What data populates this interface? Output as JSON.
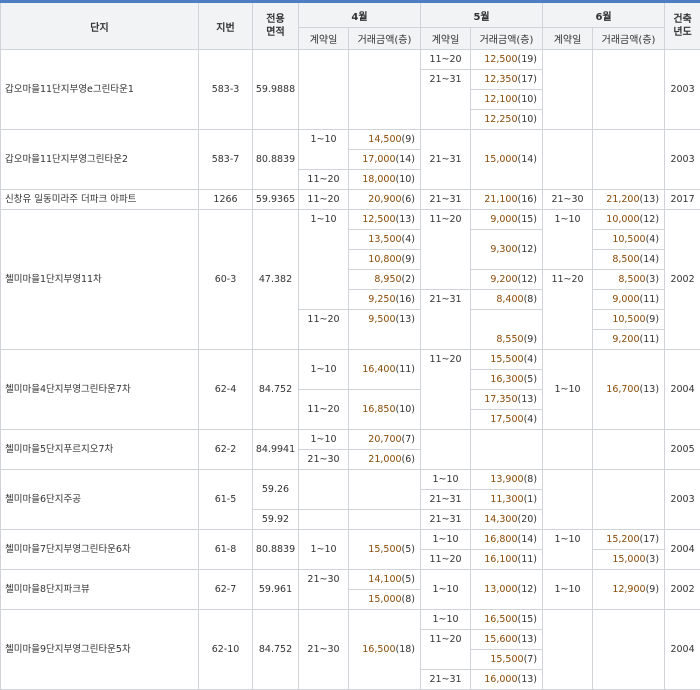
{
  "header": {
    "complex": "단지",
    "lot": "지번",
    "area_line1": "전용",
    "area_line2": "면적",
    "months": [
      "4월",
      "5월",
      "6월"
    ],
    "contract_date": "계약일",
    "deal_amount": "거래금액(층)",
    "built_line1": "건축",
    "built_line2": "년도"
  },
  "rows": [
    {
      "name": "갑오마을11단지부영e그린타운1",
      "lot": "583-3",
      "area": "59.9888",
      "year": "2003"
    },
    {
      "name": "갑오마을11단지부영그린타운2",
      "lot": "583-7",
      "area": "80.8839",
      "year": "2003"
    },
    {
      "name": "신창유 일동미라주 더파크 아파트",
      "lot": "1266",
      "area": "59.9365",
      "year": "2017"
    },
    {
      "name": "첼미마을1단지부영11차",
      "lot": "60-3",
      "area": "47.382",
      "year": "2002"
    },
    {
      "name": "첼미마을4단지부영그린타운7차",
      "lot": "62-4",
      "area": "84.752",
      "year": "2004"
    },
    {
      "name": "첼미마을5단지푸르지오7차",
      "lot": "62-2",
      "area": "84.9941",
      "year": "2005"
    },
    {
      "name": "첼미마을6단지주공",
      "lot": "61-5",
      "area_a": "59.26",
      "area_b": "59.92",
      "year": "2003"
    },
    {
      "name": "첼미마을7단지부영그린타운6차",
      "lot": "61-8",
      "area": "80.8839",
      "year": "2004"
    },
    {
      "name": "첼미마을8단지파크뷰",
      "lot": "62-7",
      "area": "59.961",
      "year": "2002"
    },
    {
      "name": "첼미마을9단지부영그린타운5차",
      "lot": "62-10",
      "area": "84.752",
      "year": "2004"
    }
  ],
  "deals": {
    "r1": {
      "m5_d1": "11~20",
      "m5_d2": "21~31",
      "m5_a": [
        "12,500",
        "12,350",
        "12,100",
        "12,250"
      ],
      "m5_f": [
        "(19)",
        "(17)",
        "(10)",
        "(10)"
      ]
    },
    "r2": {
      "m4_d1": "1~10",
      "m4_d2": "11~20",
      "m4_a": [
        "14,500",
        "17,000",
        "18,000"
      ],
      "m4_f": [
        "(9)",
        "(14)",
        "(10)"
      ],
      "m5_d1": "21~31",
      "m5_a": [
        "15,000"
      ],
      "m5_f": [
        "(14)"
      ]
    },
    "r3": {
      "m4_d": "11~20",
      "m4_a": "20,900",
      "m4_f": "(6)",
      "m5_d": "21~31",
      "m5_a": "21,100",
      "m5_f": "(16)",
      "m6_d": "21~30",
      "m6_a": "21,200",
      "m6_f": "(13)"
    },
    "r4": {
      "m4_d1": "1~10",
      "m4_d2": "11~20",
      "m4_d3": "21~30",
      "m4_a": [
        "12,500",
        "13,500",
        "10,800",
        "8,950",
        "9,250",
        "9,500"
      ],
      "m4_f": [
        "(13)",
        "(4)",
        "(9)",
        "(2)",
        "(16)",
        "(13)"
      ],
      "m5_d1": "11~20",
      "m5_d2": "21~31",
      "m5_a": [
        "9,000",
        "9,300",
        "9,200",
        "8,400",
        "8,550"
      ],
      "m5_f": [
        "(15)",
        "(12)",
        "(12)",
        "(8)",
        "(9)"
      ],
      "m6_d1": "1~10",
      "m6_d2": "11~20",
      "m6_a": [
        "10,000",
        "10,500",
        "8,500",
        "8,500",
        "9,000",
        "10,500",
        "9,200"
      ],
      "m6_f": [
        "(12)",
        "(4)",
        "(14)",
        "(3)",
        "(11)",
        "(9)",
        "(11)"
      ]
    },
    "r5": {
      "m4_d1": "1~10",
      "m4_d2": "11~20",
      "m4_a": [
        "16,400",
        "16,850"
      ],
      "m4_f": [
        "(11)",
        "(10)"
      ],
      "m5_d1": "11~20",
      "m5_a": [
        "15,500",
        "16,300",
        "17,350",
        "17,500"
      ],
      "m5_f": [
        "(4)",
        "(5)",
        "(13)",
        "(4)"
      ],
      "m6_d1": "1~10",
      "m6_a": [
        "16,700"
      ],
      "m6_f": [
        "(13)"
      ]
    },
    "r6": {
      "m4_d1": "1~10",
      "m4_d2": "21~30",
      "m4_a": [
        "20,700",
        "21,000"
      ],
      "m4_f": [
        "(7)",
        "(6)"
      ]
    },
    "r7": {
      "m5_d1": "1~10",
      "m5_d2": "21~31",
      "m5_d3": "21~31",
      "m5_a": [
        "13,900",
        "11,300",
        "14,300"
      ],
      "m5_f": [
        "(8)",
        "(1)",
        "(20)"
      ]
    },
    "r8": {
      "m4_d1": "1~10",
      "m4_a": [
        "15,500"
      ],
      "m4_f": [
        "(5)"
      ],
      "m5_d1": "1~10",
      "m5_d2": "11~20",
      "m5_a": [
        "16,800",
        "16,100"
      ],
      "m5_f": [
        "(14)",
        "(11)"
      ],
      "m6_d1": "1~10",
      "m6_a": [
        "15,200",
        "15,000"
      ],
      "m6_f": [
        "(17)",
        "(3)"
      ]
    },
    "r9": {
      "m4_d1": "21~30",
      "m4_a": [
        "14,100",
        "15,000"
      ],
      "m4_f": [
        "(5)",
        "(8)"
      ],
      "m5_d1": "1~10",
      "m5_a": [
        "13,000"
      ],
      "m5_f": [
        "(12)"
      ],
      "m6_d1": "1~10",
      "m6_a": [
        "12,900"
      ],
      "m6_f": [
        "(9)"
      ]
    },
    "r10": {
      "m4_d1": "21~30",
      "m4_a": [
        "16,500"
      ],
      "m4_f": [
        "(18)"
      ],
      "m5_d1": "1~10",
      "m5_d2": "11~20",
      "m5_d3": "21~31",
      "m5_a": [
        "16,500",
        "15,600",
        "15,500",
        "16,000"
      ],
      "m5_f": [
        "(15)",
        "(13)",
        "(7)",
        "(13)"
      ]
    }
  }
}
